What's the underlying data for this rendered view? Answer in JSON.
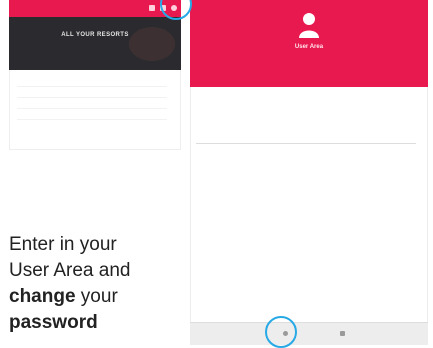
{
  "colors": {
    "accent": "#e8194f",
    "dark": "#2b2b2f",
    "highlight": "#27a9e6"
  },
  "left_screen": {
    "hero_title": "ALL YOUR RESORTS"
  },
  "right_screen": {
    "header": {
      "title": "User Area"
    }
  },
  "instruction": {
    "line1": "Enter in your",
    "line2": "User Area and",
    "line3_bold": "change",
    "line3_rest": " your",
    "line4_bold": "password"
  }
}
